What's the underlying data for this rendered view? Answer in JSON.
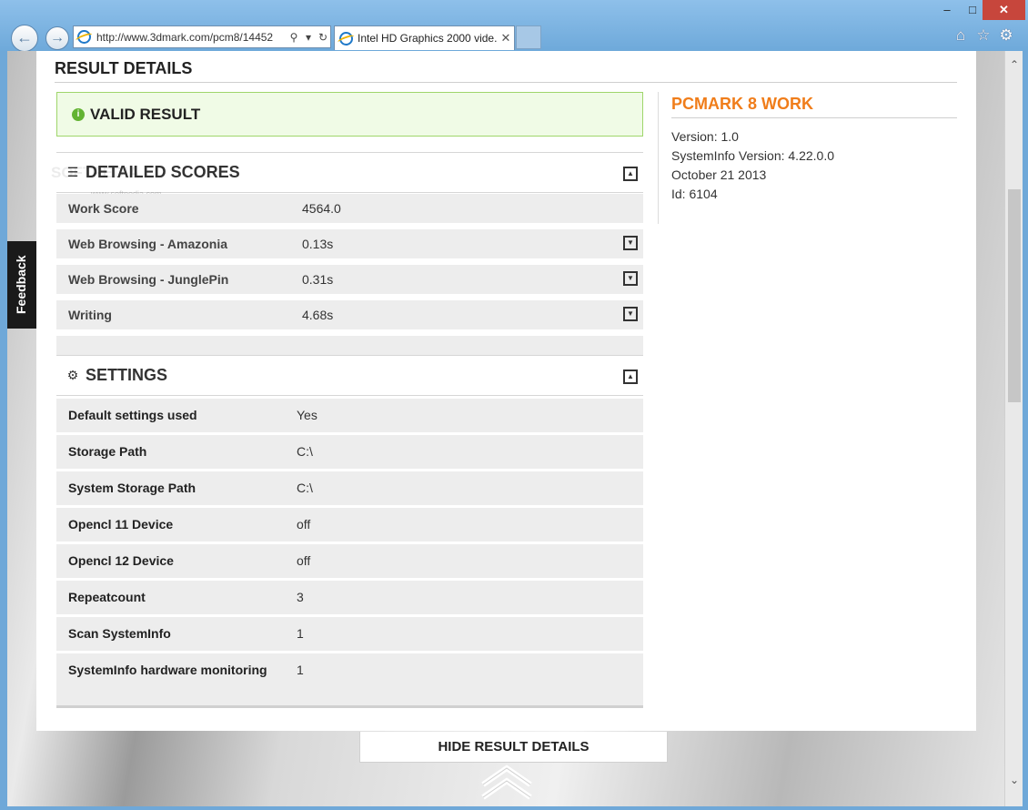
{
  "browser": {
    "address": "http://www.3dmark.com/pcm8/14452",
    "tab_title": "Intel HD Graphics 2000 vide...",
    "min": "–",
    "max": "□",
    "close": "✕",
    "home_icon": "⌂",
    "fav_icon": "☆",
    "gear_icon": "⚙"
  },
  "feedback": "Feedback",
  "page": {
    "title": "RESULT DETAILS",
    "valid_result": "VALID RESULT",
    "watermark": "SOFTPEDIA",
    "watermark_url": "www.softpedia.com",
    "detailed_scores": {
      "title": "DETAILED SCORES",
      "rows": [
        {
          "label": "Work Score",
          "value": "4564.0"
        },
        {
          "label": "Web Browsing - Amazonia",
          "value": "0.13s"
        },
        {
          "label": "Web Browsing - JunglePin",
          "value": "0.31s"
        },
        {
          "label": "Writing",
          "value": "4.68s"
        }
      ]
    },
    "settings": {
      "title": "SETTINGS",
      "rows": [
        {
          "label": "Default settings used",
          "value": "Yes"
        },
        {
          "label": "Storage Path",
          "value": "C:\\"
        },
        {
          "label": "System Storage Path",
          "value": "C:\\"
        },
        {
          "label": "Opencl 11 Device",
          "value": "off"
        },
        {
          "label": "Opencl 12 Device",
          "value": "off"
        },
        {
          "label": "Repeatcount",
          "value": "3"
        },
        {
          "label": "Scan SystemInfo",
          "value": "1"
        },
        {
          "label": "SystemInfo hardware monitoring",
          "value": "1"
        }
      ]
    },
    "sidebar": {
      "title": "PCMARK 8 WORK",
      "version": "Version: 1.0",
      "systeminfo_version": "SystemInfo Version: 4.22.0.0",
      "date": "October 21 2013",
      "id": "Id: 6104"
    },
    "hide_button": "HIDE RESULT DETAILS"
  },
  "colors": {
    "accent_orange": "#f07d1a",
    "valid_green": "#63b332",
    "chrome_blue": "#6fa8d8"
  }
}
